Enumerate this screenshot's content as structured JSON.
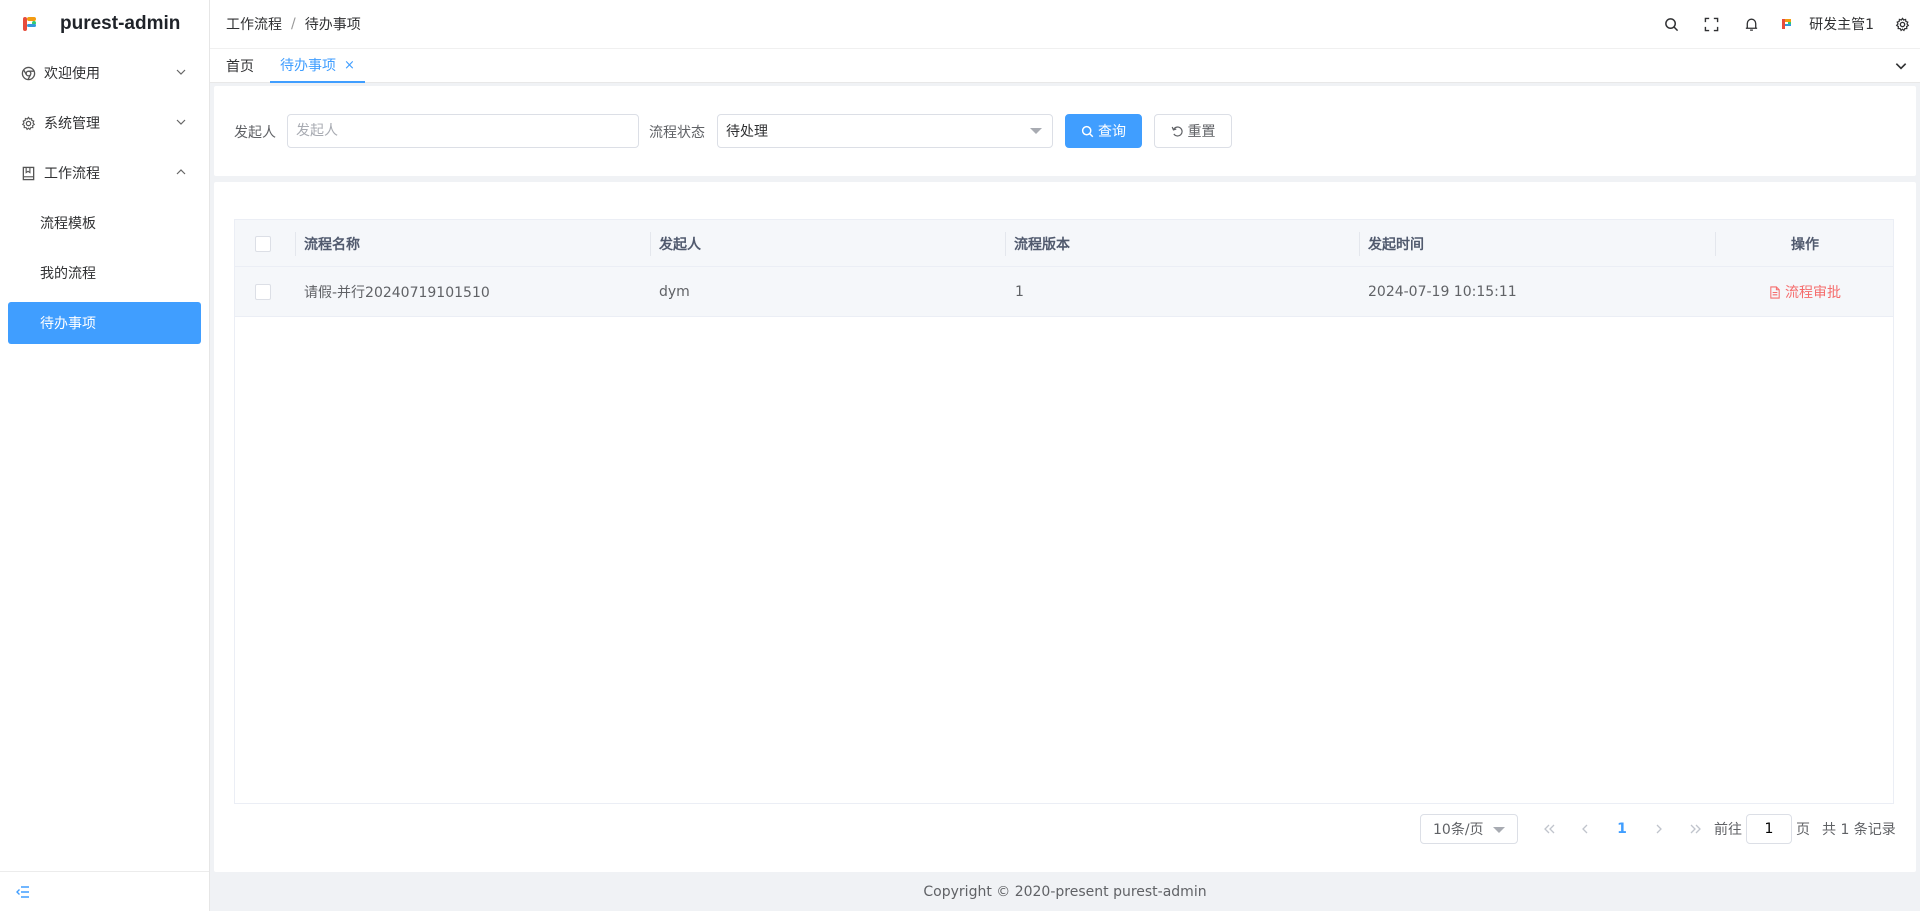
{
  "app": {
    "title": "purest-admin"
  },
  "sidebar": {
    "items": [
      {
        "label": "欢迎使用",
        "icon": "chrome-icon",
        "expanded": false
      },
      {
        "label": "系统管理",
        "icon": "gear-icon",
        "expanded": false
      },
      {
        "label": "工作流程",
        "icon": "book-icon",
        "expanded": true
      }
    ],
    "sub_items": [
      {
        "label": "流程模板",
        "active": false
      },
      {
        "label": "我的流程",
        "active": false
      },
      {
        "label": "待办事项",
        "active": true
      }
    ]
  },
  "header": {
    "breadcrumb": [
      "工作流程",
      "待办事项"
    ],
    "breadcrumb_sep": "/",
    "user_name": "研发主管1"
  },
  "tabs": [
    {
      "label": "首页",
      "active": false
    },
    {
      "label": "待办事项",
      "active": true,
      "close": "×"
    }
  ],
  "search": {
    "initiator_label": "发起人",
    "initiator_placeholder": "发起人",
    "initiator_value": "",
    "status_label": "流程状态",
    "status_value": "待处理",
    "query_label": "查询",
    "reset_label": "重置"
  },
  "table": {
    "columns": [
      "流程名称",
      "发起人",
      "流程版本",
      "发起时间",
      "操作"
    ],
    "rows": [
      {
        "name": "请假-并行20240719101510",
        "initiator": "dym",
        "version": "1",
        "time": "2024-07-19 10:15:11",
        "action": "流程审批"
      }
    ]
  },
  "pagination": {
    "page_size": "10条/页",
    "current_page": "1",
    "goto_prefix": "前往",
    "goto_value": "1",
    "goto_suffix": "页",
    "total": "共 1 条记录"
  },
  "footer": {
    "copyright": "Copyright © 2020-present purest-admin"
  },
  "colors": {
    "primary": "#409eff",
    "danger": "#f56c6c"
  }
}
